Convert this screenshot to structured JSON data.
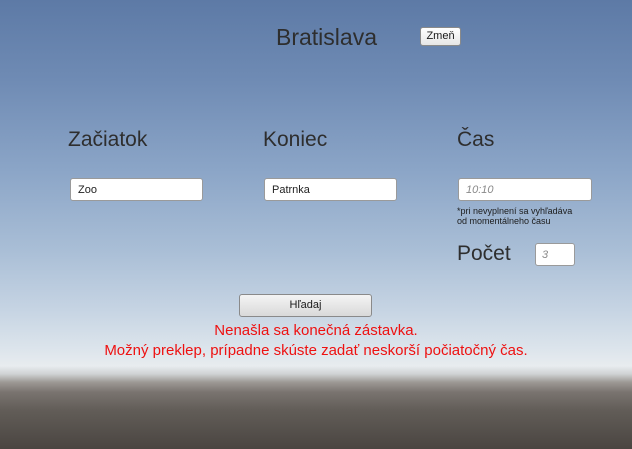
{
  "header": {
    "city": "Bratislava",
    "change_label": "Zmeň"
  },
  "form": {
    "start_label": "Začiatok",
    "start_value": "Zoo",
    "end_label": "Koniec",
    "end_value": "Patrnka",
    "time_label": "Čas",
    "time_placeholder": "10:10",
    "time_hint_line1": "*pri nevyplnení sa vyhľadáva",
    "time_hint_line2": "od momentálneho času",
    "count_label": "Počet",
    "count_placeholder": "3",
    "search_label": "Hľadaj"
  },
  "message": {
    "line1": "Nenašla sa konečná zástavka.",
    "line2": "Možný preklep, prípadne skúste zadať neskorší počiatočný čas.",
    "color": "#ee1111"
  }
}
